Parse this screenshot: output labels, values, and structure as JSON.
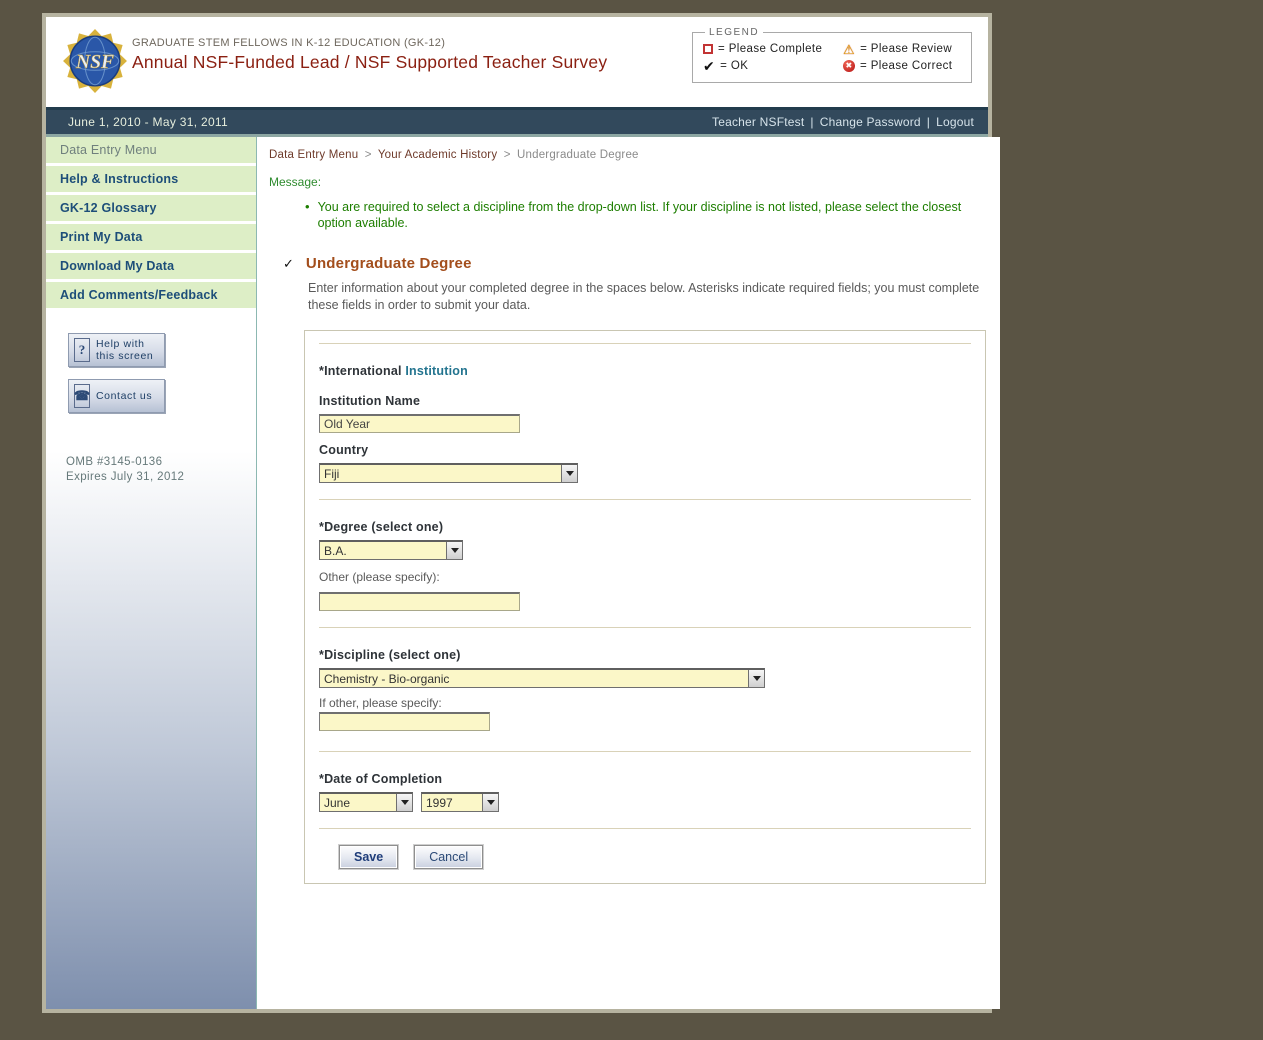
{
  "header": {
    "logo_text": "NSF",
    "program": "GRADUATE STEM FELLOWS IN K-12 EDUCATION (GK-12)",
    "title": "Annual NSF-Funded Lead / NSF Supported Teacher Survey"
  },
  "legend": {
    "title": "LEGEND",
    "items": [
      {
        "icon": "please-complete-icon",
        "text": "= Please Complete"
      },
      {
        "icon": "please-review-icon",
        "text": "= Please Review"
      },
      {
        "icon": "ok-icon",
        "text": "= OK",
        "check_glyph": "✔"
      },
      {
        "icon": "please-correct-icon",
        "text": "= Please Correct",
        "x_glyph": "✖"
      }
    ]
  },
  "navbar": {
    "date_range": "June 1, 2010 - May 31, 2011",
    "user": "Teacher NSFtest",
    "separator": "|",
    "change_password": "Change Password",
    "logout": "Logout"
  },
  "sidebar": {
    "menu": [
      {
        "label": "Data Entry Menu"
      },
      {
        "label": "Help & Instructions"
      },
      {
        "label": "GK-12 Glossary"
      },
      {
        "label": "Print My Data"
      },
      {
        "label": "Download My Data"
      },
      {
        "label": "Add Comments/Feedback"
      }
    ],
    "help_button": {
      "icon_glyph": "?",
      "line1": "Help with",
      "line2": "this screen"
    },
    "contact_button": {
      "icon_glyph": "☎",
      "label": "Contact us"
    },
    "omb_number": "OMB #3145-0136",
    "omb_expires": "Expires July 31, 2012"
  },
  "breadcrumb": [
    {
      "label": "Data Entry Menu"
    },
    {
      "label": "Your Academic History"
    },
    {
      "label": "Undergraduate Degree"
    }
  ],
  "breadcrumb_separator": ">",
  "message": {
    "label": "Message:",
    "bullet": "•",
    "items": [
      "You are required to select a discipline from the drop-down list. If your discipline is not listed, please select the closest option available."
    ]
  },
  "section": {
    "status_check": "✓",
    "title": "Undergraduate Degree",
    "intro": "Enter information about your completed degree in the spaces below. Asterisks indicate required fields; you must complete these fields in order to submit your data."
  },
  "form": {
    "international_label": "*International",
    "institution_link": "Institution",
    "institution_name_label": "Institution Name",
    "institution_name_value": "Old Year",
    "country_label": "Country",
    "country_value": "Fiji",
    "degree_label": "*Degree (select one)",
    "degree_value": "B.A.",
    "degree_other_label": "Other (please specify):",
    "degree_other_value": "",
    "discipline_label": "*Discipline (select one)",
    "discipline_value": "Chemistry - Bio-organic",
    "discipline_other_label": "If other, please specify:",
    "discipline_other_value": "",
    "date_label": "*Date of Completion",
    "month_value": "June",
    "year_value": "1997",
    "save_label": "Save",
    "cancel_label": "Cancel"
  },
  "colors": {
    "title_maroon": "#8b2012",
    "heading_sienna": "#a34e1c",
    "institution_link_teal": "#23748f",
    "message_green": "#2e8b2e",
    "bullet_green": "#1d7e00",
    "input_yellow": "#fbf7c8",
    "navbar_slate": "#32495c",
    "sidebar_menu_green": "#ddeec6",
    "sidebar_gradient_blue": "#7e8fad",
    "window_border_tan": "#b6b3a0",
    "page_background_olive": "#5a5444"
  }
}
